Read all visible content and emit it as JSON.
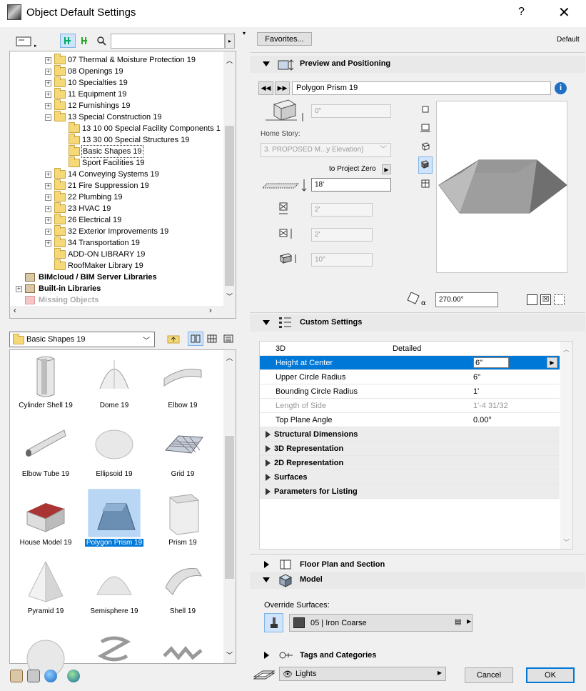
{
  "window": {
    "title": "Object Default Settings",
    "help": "?",
    "close": "✕"
  },
  "left": {
    "search": {
      "placeholder": "",
      "value": ""
    },
    "tree": [
      {
        "label": "07 Thermal & Moisture Protection 19",
        "indent": 1,
        "exp": "+"
      },
      {
        "label": "08 Openings 19",
        "indent": 1,
        "exp": "+"
      },
      {
        "label": "10 Specialties 19",
        "indent": 1,
        "exp": "+"
      },
      {
        "label": "11 Equipment 19",
        "indent": 1,
        "exp": "+"
      },
      {
        "label": "12 Furnishings 19",
        "indent": 1,
        "exp": "+"
      },
      {
        "label": "13 Special Construction 19",
        "indent": 1,
        "exp": "−"
      },
      {
        "label": "13 10 00 Special Facility Components 1",
        "indent": 2,
        "exp": ""
      },
      {
        "label": "13 30 00 Special Structures 19",
        "indent": 2,
        "exp": ""
      },
      {
        "label": "Basic Shapes 19",
        "indent": 2,
        "exp": "",
        "selected": true
      },
      {
        "label": "Sport Facilities 19",
        "indent": 2,
        "exp": ""
      },
      {
        "label": "14 Conveying Systems 19",
        "indent": 1,
        "exp": "+"
      },
      {
        "label": "21 Fire Suppression 19",
        "indent": 1,
        "exp": "+"
      },
      {
        "label": "22 Plumbing 19",
        "indent": 1,
        "exp": "+"
      },
      {
        "label": "23 HVAC 19",
        "indent": 1,
        "exp": "+"
      },
      {
        "label": "26 Electrical 19",
        "indent": 1,
        "exp": "+"
      },
      {
        "label": "32 Exterior Improvements 19",
        "indent": 1,
        "exp": "+"
      },
      {
        "label": "34 Transportation 19",
        "indent": 1,
        "exp": "+"
      },
      {
        "label": "ADD-ON LIBRARY 19",
        "indent": 1,
        "exp": ""
      },
      {
        "label": "RoofMaker Library 19",
        "indent": 1,
        "exp": ""
      }
    ],
    "tree_roots": [
      {
        "label": "BIMcloud / BIM Server Libraries",
        "bold": true
      },
      {
        "label": "Built-in Libraries",
        "bold": true,
        "exp": "+"
      },
      {
        "label": "Missing Objects",
        "bold": true,
        "dim": true
      }
    ],
    "folder_combo": "Basic Shapes 19",
    "gallery": [
      {
        "label": "Cylinder Shell 19"
      },
      {
        "label": "Dome 19"
      },
      {
        "label": "Elbow 19"
      },
      {
        "label": "Elbow Tube 19"
      },
      {
        "label": "Ellipsoid 19"
      },
      {
        "label": "Grid 19"
      },
      {
        "label": "House Model 19"
      },
      {
        "label": "Polygon Prism 19",
        "selected": true
      },
      {
        "label": "Prism 19"
      },
      {
        "label": "Pyramid 19"
      },
      {
        "label": "Semisphere 19"
      },
      {
        "label": "Shell 19"
      },
      {
        "label": ""
      },
      {
        "label": ""
      },
      {
        "label": ""
      }
    ]
  },
  "right": {
    "favorites_button": "Favorites...",
    "default_label": "Default",
    "preview_section": "Preview and Positioning",
    "object_name": "Polygon Prism 19",
    "elevation": "0\"",
    "home_story_label": "Home Story:",
    "home_story_value": "3. PROPOSED M...y Elevation)",
    "to_project_zero": "to Project Zero",
    "height_value": "18'",
    "width_value": "2'",
    "depth_value": "2'",
    "elev_value2": "10\"",
    "angle_value": "270.00°",
    "custom_section": "Custom Settings",
    "params_header": {
      "name": "3D",
      "value": "Detailed"
    },
    "params": [
      {
        "name": "Height at Center",
        "value": "6\"",
        "state": "sel"
      },
      {
        "name": "Upper Circle Radius",
        "value": "6\"",
        "state": ""
      },
      {
        "name": "Bounding Circle Radius",
        "value": "1'",
        "state": ""
      },
      {
        "name": "Length of Side",
        "value": "1'-4 31/32",
        "state": "dim"
      },
      {
        "name": "Top Plane Angle",
        "value": "0.00°",
        "state": ""
      }
    ],
    "groups": [
      "Structural Dimensions",
      "3D Representation",
      "2D Representation",
      "Surfaces",
      "Parameters for Listing"
    ],
    "floor_plan_section": "Floor Plan and Section",
    "model_section": "Model",
    "override_surfaces_label": "Override Surfaces:",
    "surface_value": "05 | Iron Coarse",
    "tags_section": "Tags and Categories",
    "layer_value": "Lights",
    "cancel": "Cancel",
    "ok": "OK"
  }
}
